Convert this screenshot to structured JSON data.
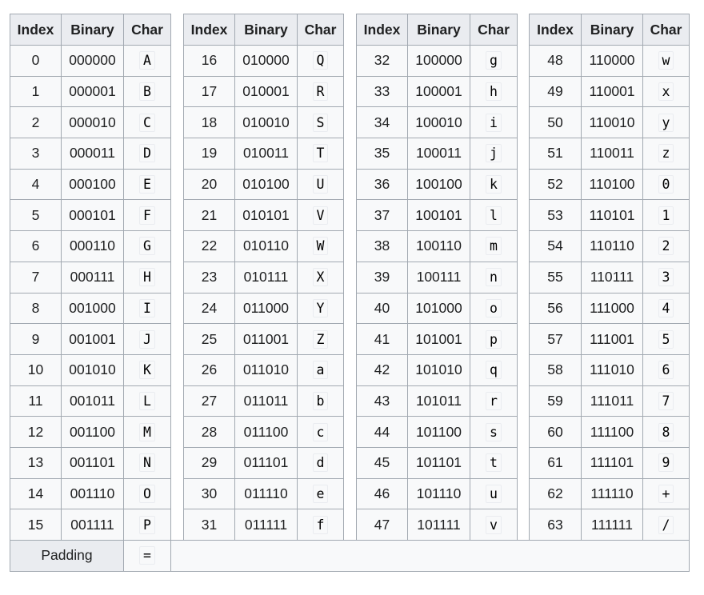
{
  "headers": [
    "Index",
    "Binary",
    "Char"
  ],
  "rows": [
    [
      "0",
      "000000",
      "A"
    ],
    [
      "1",
      "000001",
      "B"
    ],
    [
      "2",
      "000010",
      "C"
    ],
    [
      "3",
      "000011",
      "D"
    ],
    [
      "4",
      "000100",
      "E"
    ],
    [
      "5",
      "000101",
      "F"
    ],
    [
      "6",
      "000110",
      "G"
    ],
    [
      "7",
      "000111",
      "H"
    ],
    [
      "8",
      "001000",
      "I"
    ],
    [
      "9",
      "001001",
      "J"
    ],
    [
      "10",
      "001010",
      "K"
    ],
    [
      "11",
      "001011",
      "L"
    ],
    [
      "12",
      "001100",
      "M"
    ],
    [
      "13",
      "001101",
      "N"
    ],
    [
      "14",
      "001110",
      "O"
    ],
    [
      "15",
      "001111",
      "P"
    ],
    [
      "16",
      "010000",
      "Q"
    ],
    [
      "17",
      "010001",
      "R"
    ],
    [
      "18",
      "010010",
      "S"
    ],
    [
      "19",
      "010011",
      "T"
    ],
    [
      "20",
      "010100",
      "U"
    ],
    [
      "21",
      "010101",
      "V"
    ],
    [
      "22",
      "010110",
      "W"
    ],
    [
      "23",
      "010111",
      "X"
    ],
    [
      "24",
      "011000",
      "Y"
    ],
    [
      "25",
      "011001",
      "Z"
    ],
    [
      "26",
      "011010",
      "a"
    ],
    [
      "27",
      "011011",
      "b"
    ],
    [
      "28",
      "011100",
      "c"
    ],
    [
      "29",
      "011101",
      "d"
    ],
    [
      "30",
      "011110",
      "e"
    ],
    [
      "31",
      "011111",
      "f"
    ],
    [
      "32",
      "100000",
      "g"
    ],
    [
      "33",
      "100001",
      "h"
    ],
    [
      "34",
      "100010",
      "i"
    ],
    [
      "35",
      "100011",
      "j"
    ],
    [
      "36",
      "100100",
      "k"
    ],
    [
      "37",
      "100101",
      "l"
    ],
    [
      "38",
      "100110",
      "m"
    ],
    [
      "39",
      "100111",
      "n"
    ],
    [
      "40",
      "101000",
      "o"
    ],
    [
      "41",
      "101001",
      "p"
    ],
    [
      "42",
      "101010",
      "q"
    ],
    [
      "43",
      "101011",
      "r"
    ],
    [
      "44",
      "101100",
      "s"
    ],
    [
      "45",
      "101101",
      "t"
    ],
    [
      "46",
      "101110",
      "u"
    ],
    [
      "47",
      "101111",
      "v"
    ],
    [
      "48",
      "110000",
      "w"
    ],
    [
      "49",
      "110001",
      "x"
    ],
    [
      "50",
      "110010",
      "y"
    ],
    [
      "51",
      "110011",
      "z"
    ],
    [
      "52",
      "110100",
      "0"
    ],
    [
      "53",
      "110101",
      "1"
    ],
    [
      "54",
      "110110",
      "2"
    ],
    [
      "55",
      "110111",
      "3"
    ],
    [
      "56",
      "111000",
      "4"
    ],
    [
      "57",
      "111001",
      "5"
    ],
    [
      "58",
      "111010",
      "6"
    ],
    [
      "59",
      "111011",
      "7"
    ],
    [
      "60",
      "111100",
      "8"
    ],
    [
      "61",
      "111101",
      "9"
    ],
    [
      "62",
      "111110",
      "+"
    ],
    [
      "63",
      "111111",
      "/"
    ]
  ],
  "padding": {
    "label": "Padding",
    "char": "="
  }
}
